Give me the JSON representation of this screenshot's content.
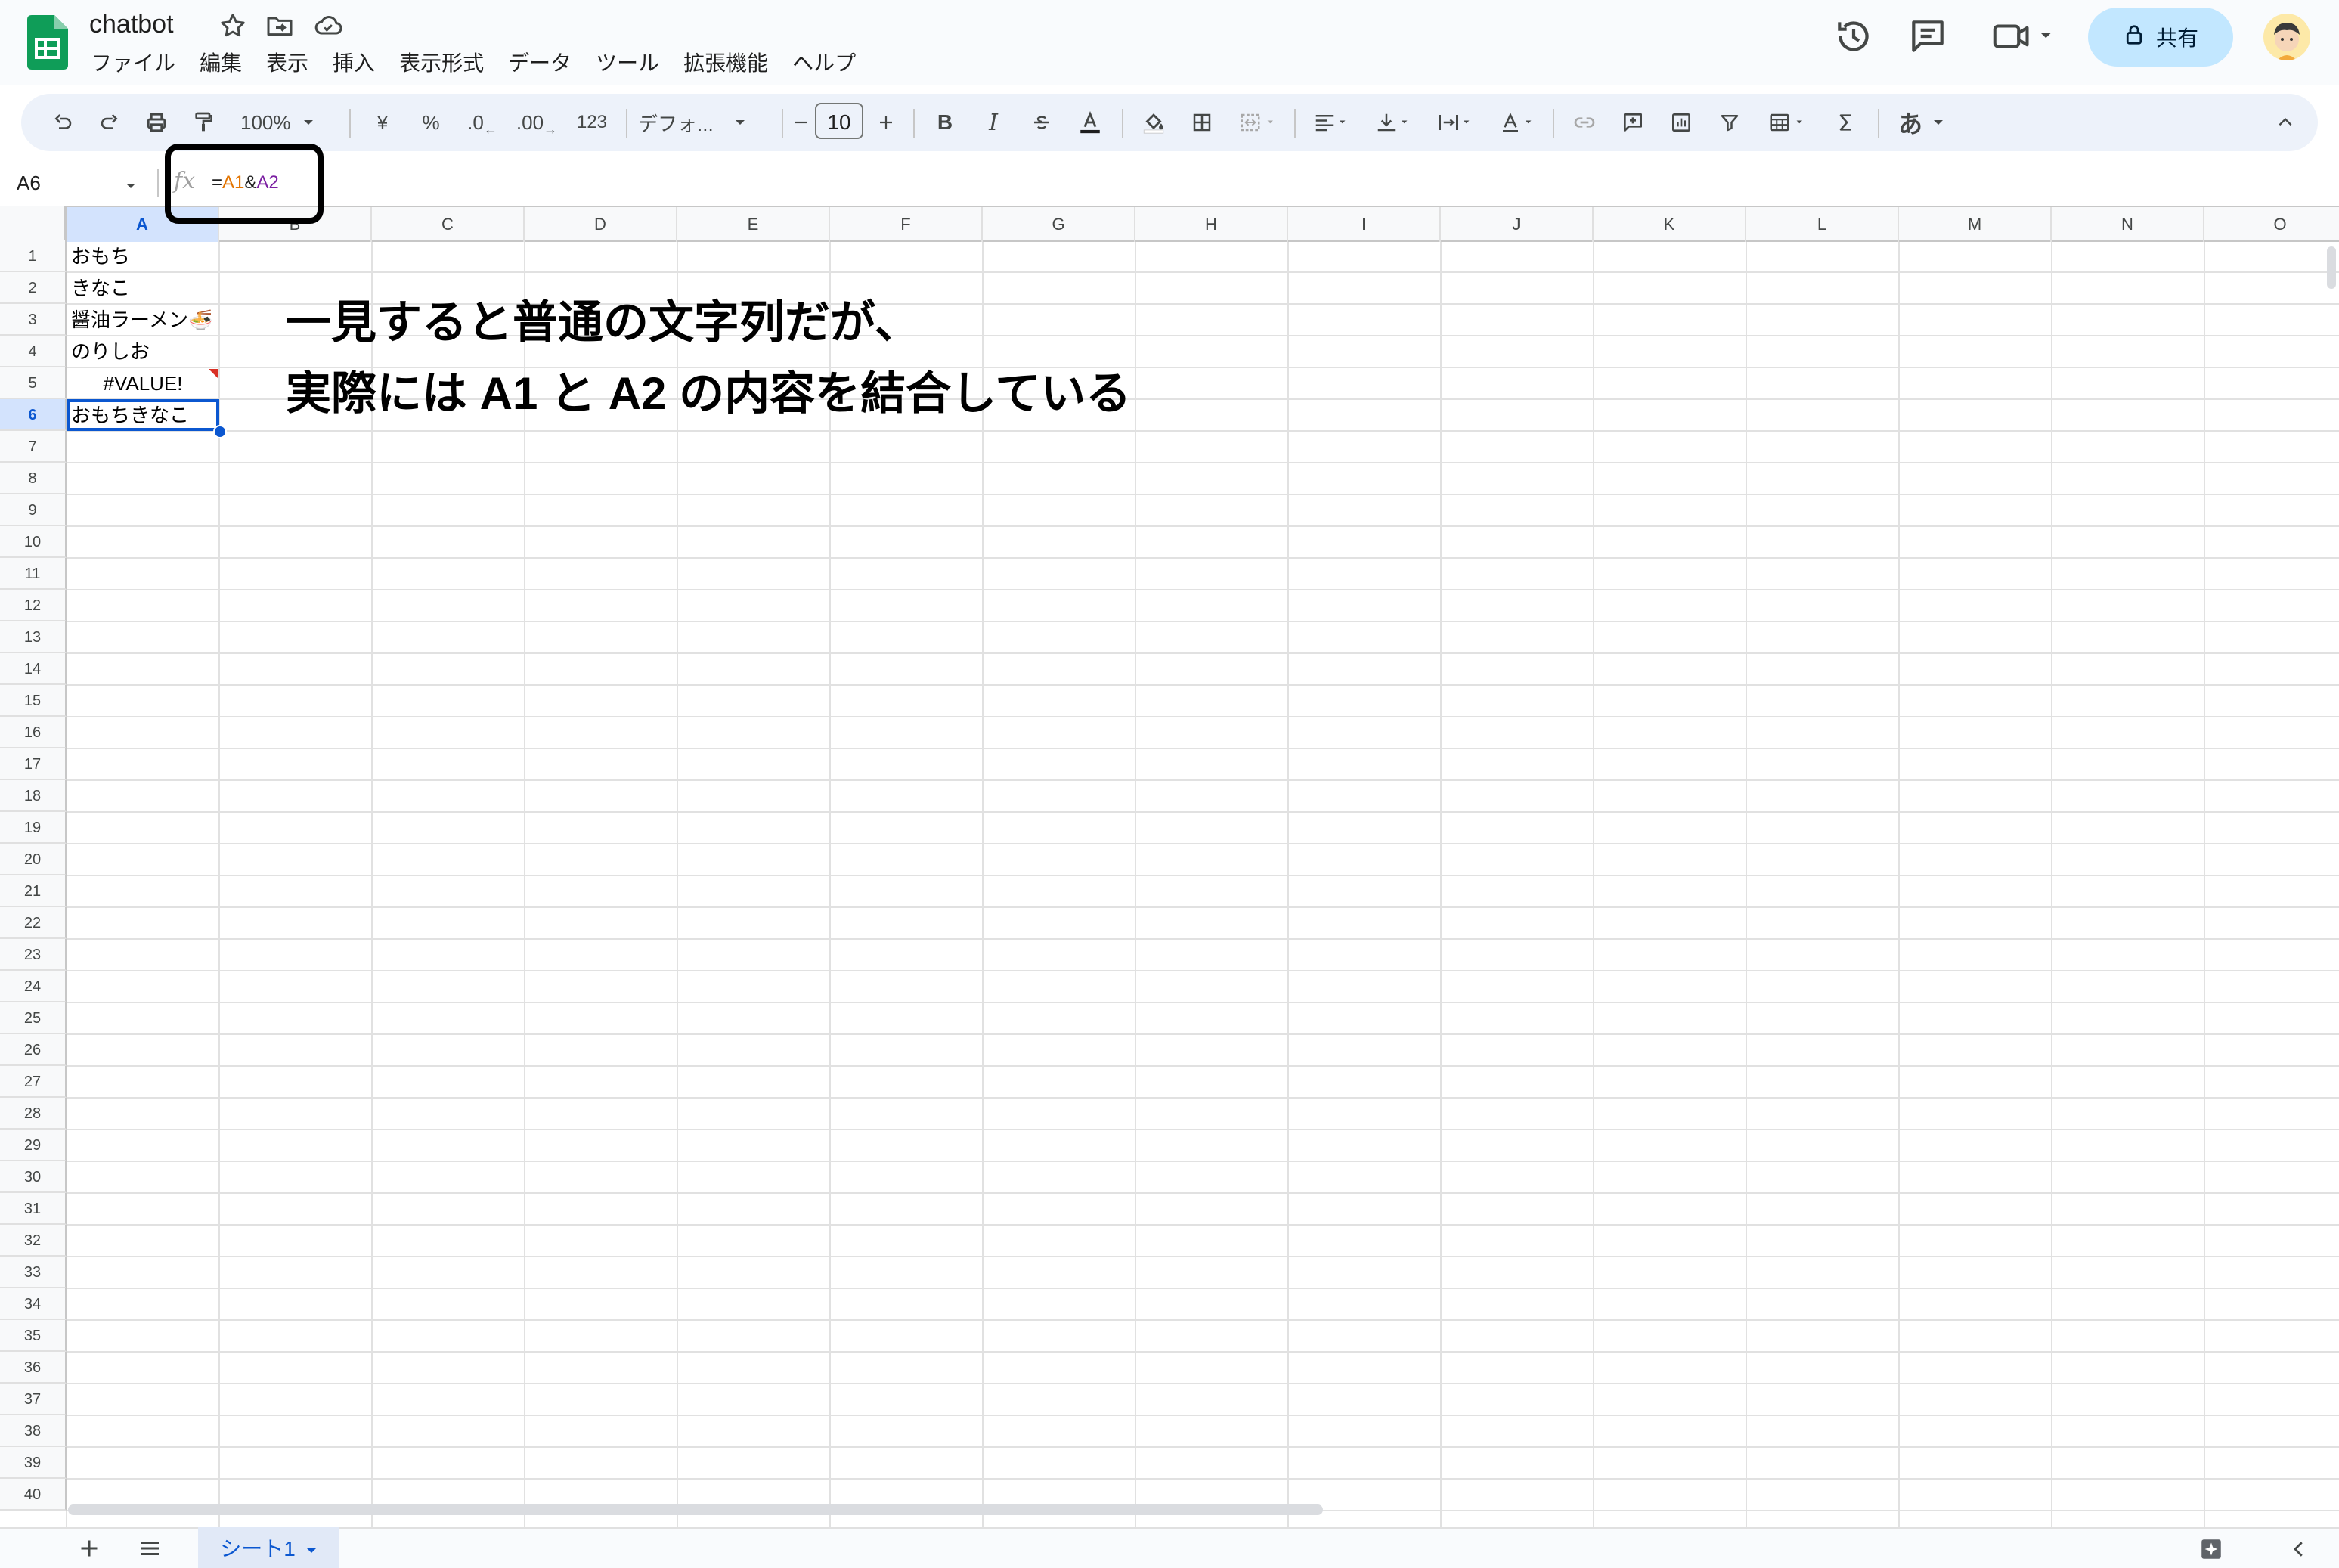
{
  "app": {
    "title": "chatbot",
    "accent_color": "#0f9d58"
  },
  "menu": [
    "ファイル",
    "編集",
    "表示",
    "挿入",
    "表示形式",
    "データ",
    "ツール",
    "拡張機能",
    "ヘルプ"
  ],
  "header_right": {
    "share_label": "共有"
  },
  "toolbar": {
    "zoom": "100%",
    "currency": "¥",
    "percent": "%",
    "decrease_decimal": ".0",
    "increase_decimal": ".00",
    "number_format": "123",
    "font_name": "デフォ...",
    "font_size": "10",
    "bold": "B",
    "italic": "I",
    "input_tools": "あ"
  },
  "formula_bar": {
    "name_box": "A6",
    "fx": "fx",
    "formula_prefix": "=",
    "formula_ref1": "A1",
    "formula_op": "&",
    "formula_ref2": "A2"
  },
  "columns": [
    "A",
    "B",
    "C",
    "D",
    "E",
    "F",
    "G",
    "H",
    "I",
    "J",
    "K",
    "L",
    "M",
    "N",
    "O"
  ],
  "rows": [
    "1",
    "2",
    "3",
    "4",
    "5",
    "6",
    "7",
    "8",
    "9",
    "10",
    "11",
    "12",
    "13",
    "14",
    "15",
    "16",
    "17",
    "18",
    "19",
    "20",
    "21",
    "22",
    "23",
    "24",
    "25",
    "26",
    "27",
    "28",
    "29",
    "30",
    "31",
    "32",
    "33",
    "34",
    "35",
    "36",
    "37",
    "38",
    "39",
    "40"
  ],
  "cells": {
    "a1": "おもち",
    "a2": "きなこ",
    "a3": "醤油ラーメン🍜",
    "a4": "のりしお",
    "a5": "#VALUE!",
    "a6": "おもちきなこ"
  },
  "annotation": {
    "line1": "一見すると普通の文字列だが、",
    "line2": "実際には A1 と A2 の内容を結合している"
  },
  "sheets": {
    "active_tab": "シート1"
  }
}
